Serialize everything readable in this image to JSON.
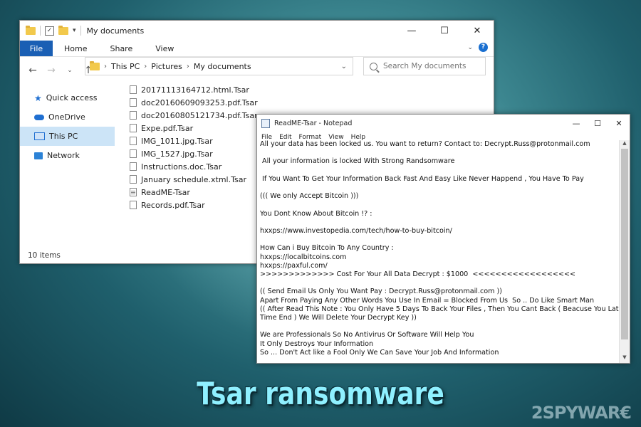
{
  "explorer": {
    "title": "My documents",
    "ribbon_tabs": [
      "File",
      "Home",
      "Share",
      "View"
    ],
    "breadcrumb": [
      "This PC",
      "Pictures",
      "My documents"
    ],
    "search_placeholder": "Search My documents",
    "sidebar": [
      "Quick access",
      "OneDrive",
      "This PC",
      "Network"
    ],
    "files": [
      "20171113164712.html.Tsar",
      "doc20160609093253.pdf.Tsar",
      "doc20160805121734.pdf.Tsar",
      "Expe.pdf.Tsar",
      "IMG_1011.jpg.Tsar",
      "IMG_1527.jpg.Tsar",
      "Instructions.doc.Tsar",
      "January schedule.xtml.Tsar",
      "ReadME-Tsar",
      "Records.pdf.Tsar"
    ],
    "status": "10 items"
  },
  "notepad": {
    "title": "ReadME-Tsar - Notepad",
    "menu": [
      "File",
      "Edit",
      "Format",
      "View",
      "Help"
    ],
    "text": "All your data has been locked us. You want to return? Contact to: Decrypt.Russ@protonmail.com\n\n All your information is locked With Strong Randsomware\n\n If You Want To Get Your Information Back Fast And Easy Like Never Happend , You Have To Pay\n\n((( We only Accept Bitcoin )))\n\nYou Dont Know About Bitcoin !? :\n\nhxxps://www.investopedia.com/tech/how-to-buy-bitcoin/\n\nHow Can i Buy Bitcoin To Any Country :\nhxxps://localbitcoins.com\nhxxps://paxful.com/\n>>>>>>>>>>>>> Cost For Your All Data Decrypt : $1000  <<<<<<<<<<<<<<<<<<\n\n(( Send Email Us Only You Want Pay : Decrypt.Russ@protonmail.com ))\nApart From Paying Any Other Words You Use In Email = Blocked From Us  So .. Do Like Smart Man\n(( After Read This Note : You Only Have 5 Days To Back Your Files , Then You Cant Back ( Beacuse You Late\nTime End ) We Will Delete Your Decrypt Key ))\n\nWe are Professionals So No Antivirus Or Software Will Help You\nIt Only Destroys Your Information\nSo ... Don't Act like a Fool Only We Can Save Your Job And Information"
  },
  "caption": "Tsar ransomware",
  "watermark": "2SPYWAR€",
  "colors": {
    "file_tab": "#1a5fb4",
    "sidebar_active": "#cce4f7",
    "caption": "#8ff0ff"
  }
}
